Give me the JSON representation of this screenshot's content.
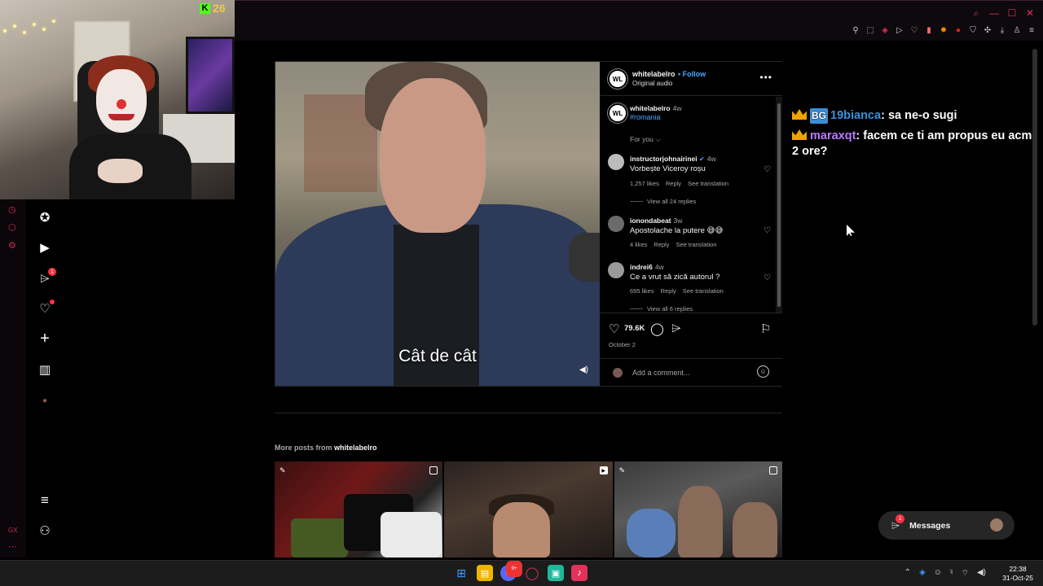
{
  "stream_overlay": {
    "kick_viewer_count": "26",
    "chat": [
      {
        "user": "19bianca",
        "badge": "BG",
        "message": "sa ne-o sugi"
      },
      {
        "user": "maraxqt",
        "message": "facem ce ti am propus eu acm 2 ore?"
      }
    ]
  },
  "browser": {
    "theme_accent": "#e0325a"
  },
  "ig_nav": {
    "notifications_badge": "1"
  },
  "post": {
    "username": "whitelabelro",
    "follow_label": "Follow",
    "audio_label": "Original audio",
    "more_icon": "•••",
    "subtitle": "Cât de cât",
    "caption": {
      "username": "whitelabelro",
      "time": "4w",
      "hashtag": "#romania"
    },
    "for_you_label": "For you",
    "comments": [
      {
        "user": "instructorjohnairinei",
        "verified": true,
        "time": "4w",
        "text": "Vorbește Viceroy roșu",
        "likes": "1,257 likes",
        "reply": "Reply",
        "translate": "See translation",
        "view_replies": "View all 24 replies"
      },
      {
        "user": "ionondabeat",
        "verified": false,
        "time": "3w",
        "text": "Apostolache la putere 😅😅",
        "likes": "4 likes",
        "reply": "Reply",
        "translate": "See translation"
      },
      {
        "user": "indrei6",
        "verified": false,
        "time": "4w",
        "text": "Ce a vrut să zică autorul ?",
        "likes": "695 likes",
        "reply": "Reply",
        "translate": "See translation",
        "view_replies": "View all 6 replies"
      }
    ],
    "like_count": "79.6K",
    "date": "October 2",
    "add_comment_placeholder": "Add a comment..."
  },
  "more_posts": {
    "prefix": "More posts from",
    "username": "whitelabelro"
  },
  "messages": {
    "label": "Messages",
    "badge": "1"
  },
  "taskbar": {
    "time": "22:38",
    "date": "31-Oct-25",
    "discord_badge": "9+"
  },
  "gx": {
    "label": "GX"
  }
}
